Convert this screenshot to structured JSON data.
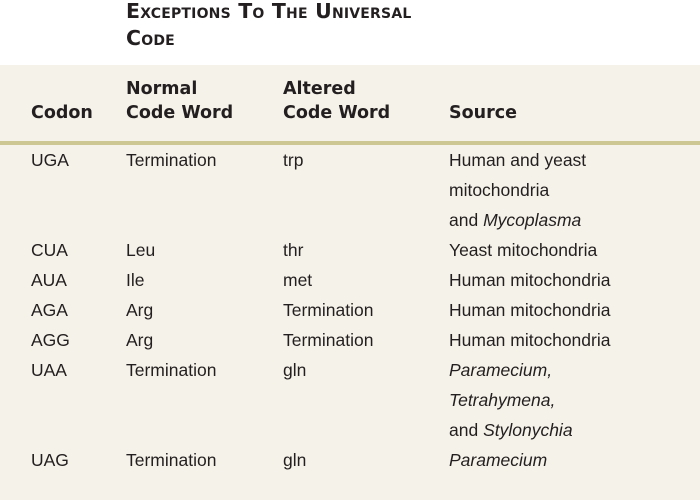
{
  "title": {
    "line1": "Exceptions to the Universal",
    "line2": "Code",
    "full": "Exceptions to the Universal Code"
  },
  "colors": {
    "page_background": "#ffffff",
    "panel_background": "#f5f2e9",
    "rule": "#cdc793",
    "text": "#231f20"
  },
  "table": {
    "headers": {
      "codon": "Codon",
      "normal_code_word": "Normal\nCode Word",
      "altered_code_word": "Altered\nCode Word",
      "source": "Source"
    },
    "rows": [
      {
        "codon": "UGA",
        "normal": "Termination",
        "altered": "trp",
        "source_text": "Human and yeast mitochondria and Mycoplasma",
        "source_lines": [
          {
            "text": "Human and yeast",
            "italic_parts": []
          },
          {
            "text": "mitochondria",
            "italic_parts": []
          },
          {
            "text": "and Mycoplasma",
            "italic_parts": [
              "Mycoplasma"
            ]
          }
        ],
        "source_indent": true,
        "gap_after": 0
      },
      {
        "codon": "CUA",
        "normal": "Leu",
        "altered": "thr",
        "source_text": "Yeast mitochondria",
        "source_lines": [
          {
            "text": "Yeast mitochondria",
            "italic_parts": []
          }
        ],
        "source_indent": false,
        "gap_after": 0
      },
      {
        "codon": "AUA",
        "normal": "Ile",
        "altered": "met",
        "source_text": "Human mitochondria",
        "source_lines": [
          {
            "text": "Human mitochondria",
            "italic_parts": []
          }
        ],
        "source_indent": false,
        "gap_after": 0
      },
      {
        "codon": "AGA",
        "normal": "Arg",
        "altered": "Termination",
        "source_text": "Human mitochondria",
        "source_lines": [
          {
            "text": "Human mitochondria",
            "italic_parts": []
          }
        ],
        "source_indent": false,
        "gap_after": 0
      },
      {
        "codon": "AGG",
        "normal": "Arg",
        "altered": "Termination",
        "source_text": "Human mitochondria",
        "source_lines": [
          {
            "text": "Human mitochondria",
            "italic_parts": []
          }
        ],
        "source_indent": false,
        "gap_after": 0
      },
      {
        "codon": "UAA",
        "normal": "Termination",
        "altered": "gln",
        "source_text": "Paramecium, Tetrahymena, and Stylonychia",
        "source_lines": [
          {
            "text": "Paramecium,",
            "italic_parts": [
              "Paramecium,"
            ]
          },
          {
            "text": "Tetrahymena,",
            "italic_parts": [
              "Tetrahymena,"
            ]
          },
          {
            "text": "and Stylonychia",
            "italic_parts": [
              "Stylonychia"
            ]
          }
        ],
        "source_indent": false,
        "gap_after": 0
      },
      {
        "codon": "UAG",
        "normal": "Termination",
        "altered": "gln",
        "source_text": "Paramecium",
        "source_lines": [
          {
            "text": "Paramecium",
            "italic_parts": [
              "Paramecium"
            ]
          }
        ],
        "source_indent": false,
        "gap_after": 0
      }
    ]
  }
}
